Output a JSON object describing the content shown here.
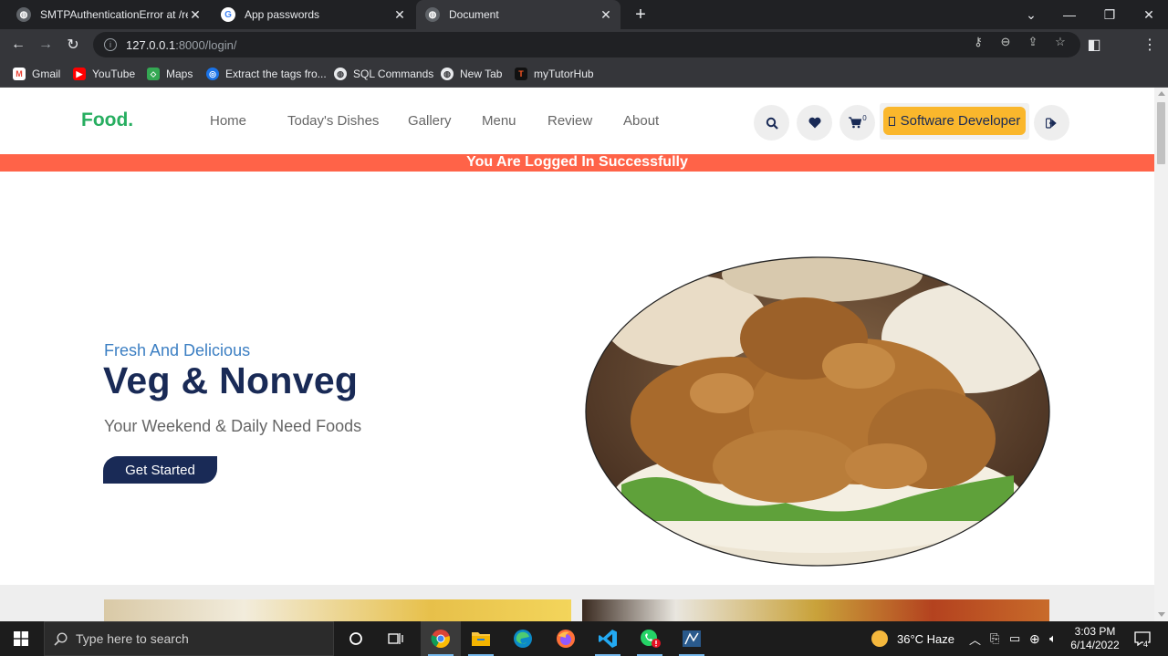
{
  "browser": {
    "tabs": [
      {
        "title": "SMTPAuthenticationError at /reg",
        "active": false
      },
      {
        "title": "App passwords",
        "active": false
      },
      {
        "title": "Document",
        "active": true
      }
    ],
    "new_tab": "+",
    "address": {
      "host": "127.0.0.1",
      "path": ":8000/login/"
    },
    "bookmarks": [
      {
        "label": "Gmail",
        "icon": "gmail-icon"
      },
      {
        "label": "YouTube",
        "icon": "youtube-icon"
      },
      {
        "label": "Maps",
        "icon": "maps-icon"
      },
      {
        "label": "Extract the tags fro...",
        "icon": "globe-icon"
      },
      {
        "label": "SQL Commands",
        "icon": "globe-icon"
      },
      {
        "label": "New Tab",
        "icon": "globe-icon"
      },
      {
        "label": "myTutorHub",
        "icon": "mytutorhub-icon"
      }
    ]
  },
  "site": {
    "logo": "Food.",
    "nav": [
      "Home",
      "Today's Dishes",
      "Gallery",
      "Menu",
      "Review",
      "About"
    ],
    "cart_count": "0",
    "profile_label": "Software Developer",
    "alert": "You Are Logged In Successfully"
  },
  "hero": {
    "subtitle": "Fresh And Delicious",
    "title": "Veg & Nonveg",
    "text": "Your Weekend & Daily Need Foods",
    "button": "Get Started"
  },
  "taskbar": {
    "search_placeholder": "Type here to search",
    "weather": "36°C  Haze",
    "time": "3:03 PM",
    "date": "6/14/2022",
    "notifications": "4"
  },
  "colors": {
    "brand_green": "#27ae60",
    "navy": "#192a56",
    "alert": "#ff6348",
    "profile_btn": "#fab72c"
  }
}
